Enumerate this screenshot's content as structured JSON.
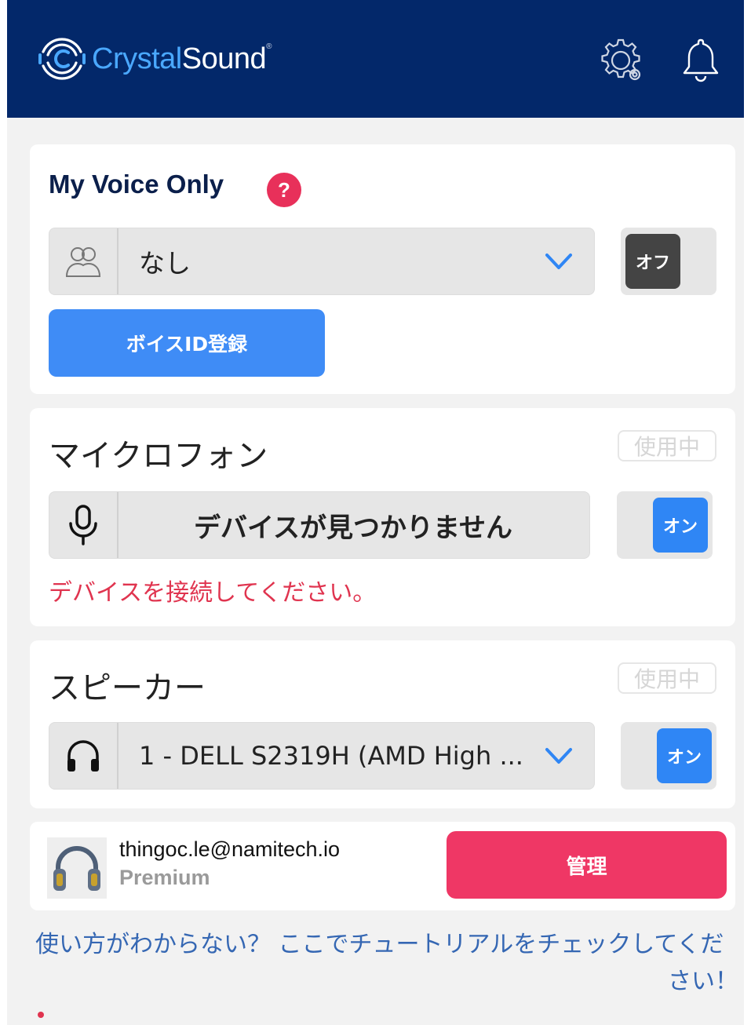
{
  "header": {
    "brand_part1": "Crystal",
    "brand_part2": "Sound",
    "brand_mark": "®",
    "icons": [
      "settings-gear-icon",
      "notification-bell-icon"
    ]
  },
  "voice_only": {
    "title": "My Voice Only",
    "help": "?",
    "selected_voice": "なし",
    "toggle_label": "オフ",
    "toggle_state": "off",
    "register_button": "ボイスID登録"
  },
  "microphone": {
    "title": "マイクロフォン",
    "status_badge": "使用中",
    "device": "デバイスが見つかりません",
    "toggle_label": "オン",
    "toggle_state": "on",
    "error": "デバイスを接続してください。"
  },
  "speaker": {
    "title": "スピーカー",
    "status_badge": "使用中",
    "device": "1 - DELL S2319H (AMD High ...",
    "toggle_label": "オン",
    "toggle_state": "on"
  },
  "account": {
    "email": "thingoc.le@namitech.io",
    "plan": "Premium",
    "manage_button": "管理"
  },
  "footer": {
    "tutorial_line1": "使い方がわからない？ ここでチュートリアルをチェックしてくだ",
    "tutorial_line2": "さい！"
  },
  "colors": {
    "header_bg": "#03286a",
    "accent_blue": "#3f8cf6",
    "accent_red": "#ef3765",
    "error_red": "#e0344f",
    "link_blue": "#3567b3"
  }
}
